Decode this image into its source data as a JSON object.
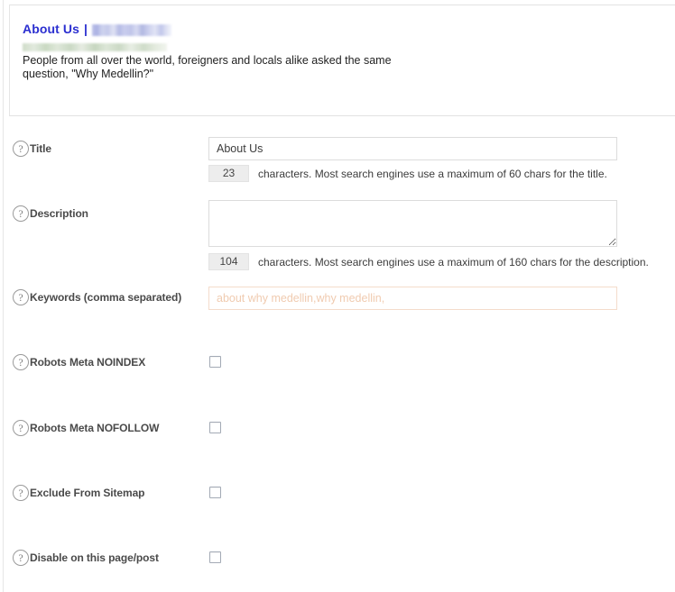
{
  "preview": {
    "title_text": "About Us",
    "title_separator": "|",
    "redacted_site_name": "",
    "redacted_url": "",
    "description": "People from all over the world, foreigners and locals alike asked the same question, \"Why Medellin?\""
  },
  "colors": {
    "preview_title": "#2b2fd0",
    "keywords_text": "#f0cbb0",
    "counter_bg": "#ededed",
    "input_border": "#dcdcdc",
    "checkbox_border": "#a3aab5"
  },
  "icons": {
    "help": "?"
  },
  "fields": {
    "title": {
      "label": "Title",
      "value": "About Us",
      "placeholder": "",
      "counter": "23",
      "counter_text": "characters. Most search engines use a maximum of 60 chars for the title."
    },
    "description": {
      "label": "Description",
      "value": "",
      "placeholder": "",
      "counter": "104",
      "counter_text": "characters. Most search engines use a maximum of 160 chars for the description."
    },
    "keywords": {
      "label": "Keywords (comma separated)",
      "value": "",
      "placeholder": "about why medellin,why medellin,"
    }
  },
  "checkboxes": [
    {
      "label": "Robots Meta NOINDEX",
      "checked": false
    },
    {
      "label": "Robots Meta NOFOLLOW",
      "checked": false
    },
    {
      "label": "Exclude From Sitemap",
      "checked": false
    },
    {
      "label": "Disable on this page/post",
      "checked": false
    }
  ]
}
